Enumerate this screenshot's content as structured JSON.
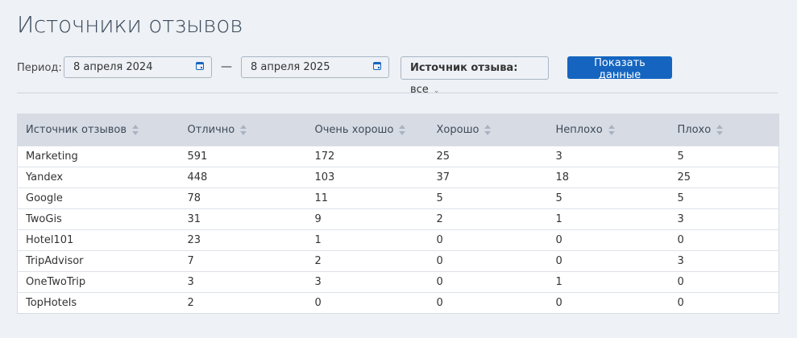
{
  "title": "Источники отзывов",
  "filters": {
    "period_label": "Период:",
    "date_from": "8 апреля 2024",
    "separator": "—",
    "date_to": "8 апреля 2025",
    "source_label": "Источник отзыва:",
    "source_value": "все",
    "submit_label": "Показать данные"
  },
  "colors": {
    "accent": "#1565c0",
    "header_bg": "#d7dce4",
    "page_bg": "#eef1f5"
  },
  "table": {
    "columns": [
      "Источник отзывов",
      "Отлично",
      "Очень хорошо",
      "Хорошо",
      "Неплохо",
      "Плохо"
    ],
    "rows": [
      [
        "Marketing",
        "591",
        "172",
        "25",
        "3",
        "5"
      ],
      [
        "Yandex",
        "448",
        "103",
        "37",
        "18",
        "25"
      ],
      [
        "Google",
        "78",
        "11",
        "5",
        "5",
        "5"
      ],
      [
        "TwoGis",
        "31",
        "9",
        "2",
        "1",
        "3"
      ],
      [
        "Hotel101",
        "23",
        "1",
        "0",
        "0",
        "0"
      ],
      [
        "TripAdvisor",
        "7",
        "2",
        "0",
        "0",
        "3"
      ],
      [
        "OneTwoTrip",
        "3",
        "3",
        "0",
        "1",
        "0"
      ],
      [
        "TopHotels",
        "2",
        "0",
        "0",
        "0",
        "0"
      ]
    ]
  }
}
